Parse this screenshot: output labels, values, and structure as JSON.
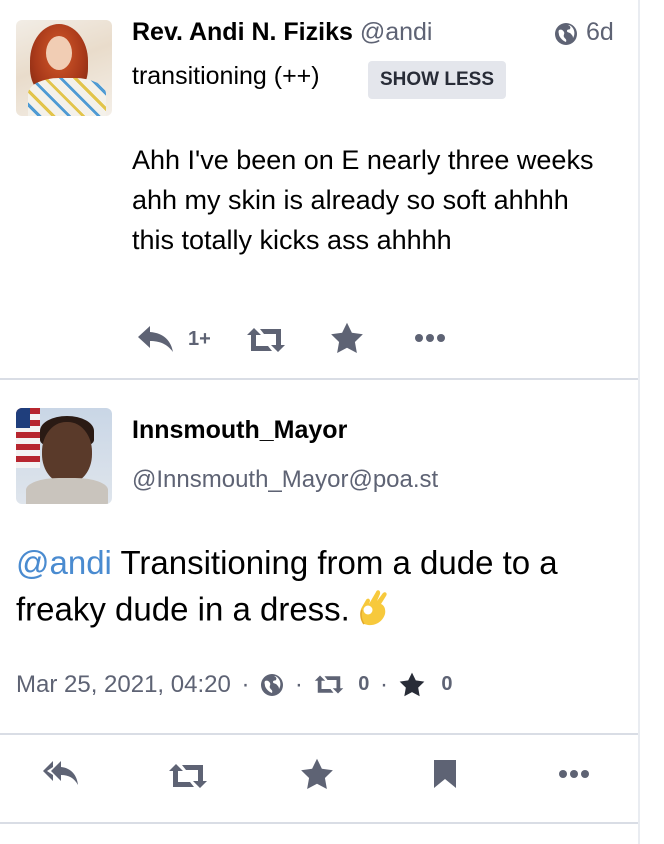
{
  "status1": {
    "display_name": "Rev. Andi N. Fiziks",
    "handle": "@andi",
    "visibility_icon": "globe-icon",
    "relative_time": "6d",
    "content_warning": "transitioning (++)",
    "toggle_label": "SHOW LESS",
    "content": "Ahh I've been on E nearly three weeks ahh my skin is already so soft ahhhh this totally kicks ass ahhhh",
    "actions": {
      "reply_icon": "reply-all-icon",
      "reply_count": "1+",
      "boost_icon": "retweet-icon",
      "favourite_icon": "star-icon",
      "more_icon": "ellipsis-icon"
    }
  },
  "status2": {
    "display_name": "Innsmouth_Mayor",
    "handle": "@Innsmouth_Mayor@poa.st",
    "mention": "@andi",
    "content": " Transitioning from a dude to a freaky dude in a dress.",
    "emoji": "ok-hand-emoji",
    "timestamp": "Mar 25, 2021, 04:20",
    "separator": "·",
    "visibility_icon": "globe-icon",
    "boost_count": "0",
    "favourite_count": "0",
    "actions": {
      "reply_icon": "reply-all-icon",
      "boost_icon": "retweet-icon",
      "favourite_icon": "star-icon",
      "bookmark_icon": "bookmark-icon",
      "more_icon": "ellipsis-icon"
    }
  },
  "colors": {
    "text_secondary": "#5e6374",
    "icon_gray": "#5e6374",
    "mention_blue": "#4a8bd0",
    "button_bg": "#e4e6ec",
    "divider": "#d9dde5"
  }
}
